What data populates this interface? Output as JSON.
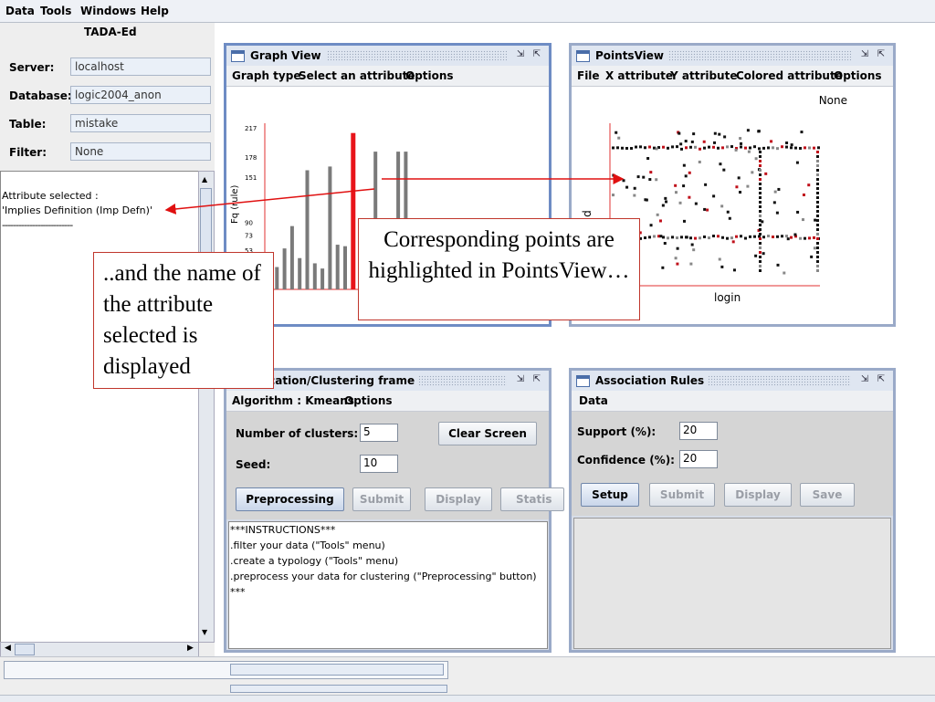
{
  "menubar": {
    "items": [
      "Data",
      "Tools",
      "Windows",
      "Help"
    ]
  },
  "left": {
    "app_title": "TADA-Ed",
    "server_label": "Server:",
    "server_value": "localhost",
    "database_label": "Database:",
    "database_value": "logic2004_anon",
    "table_label": "Table:",
    "table_value": "mistake",
    "filter_label": "Filter:",
    "filter_value": "None",
    "output_lines": [
      "Attribute selected :",
      "'Implies Definition (Imp Defn)'",
      "--------------------------"
    ]
  },
  "graph_view": {
    "title": "Graph View",
    "menu": [
      "Graph type",
      "Select an attribute",
      "Options"
    ],
    "ylabel": "Fq (rule)",
    "yticks": [
      "217",
      "178",
      "151",
      "90",
      "73",
      "53"
    ]
  },
  "points_view": {
    "title": "PointsView",
    "menu": [
      "File",
      "X attribute",
      "Y attribute",
      "Colored attribute",
      "Options"
    ],
    "legend_value": "None",
    "xlabel": "login",
    "ylabel_fragment": "d"
  },
  "classification": {
    "title": "sification/Clustering frame",
    "menu": [
      "Algorithm : Kmeans",
      "Options"
    ],
    "clusters_label": "Number of clusters:",
    "clusters_value": "5",
    "seed_label": "Seed:",
    "seed_value": "10",
    "clear_label": "Clear Screen",
    "buttons": [
      "Preprocessing",
      "Submit",
      "Display",
      "Statis"
    ],
    "instructions": [
      "***INSTRUCTIONS***",
      ".filter your data (\"Tools\" menu)",
      ".create a typology (\"Tools\" menu)",
      ".preprocess your data for clustering (\"Preprocessing\" button)",
      "***"
    ]
  },
  "association": {
    "title": "Association Rules",
    "menu": [
      "Data"
    ],
    "support_label": "Support (%):",
    "support_value": "20",
    "confidence_label": "Confidence (%):",
    "confidence_value": "20",
    "buttons": [
      "Setup",
      "Submit",
      "Display",
      "Save"
    ]
  },
  "callouts": {
    "left_text": "..and the name of the attribute selected is displayed",
    "right_text": "Corresponding points are highlighted in PointsView…"
  },
  "chart_data": {
    "type": "bar",
    "ylabel": "Fq (rule)",
    "yticks": [
      217,
      178,
      151,
      90,
      73,
      53
    ],
    "values": [
      40,
      30,
      55,
      85,
      42,
      160,
      35,
      28,
      165,
      60,
      58,
      210,
      40,
      25,
      185,
      35,
      40,
      185,
      185
    ],
    "highlight_index": 11,
    "colors": {
      "bar": "#7a7a7a",
      "highlight": "#e8141a",
      "axis": "#e03030"
    }
  }
}
